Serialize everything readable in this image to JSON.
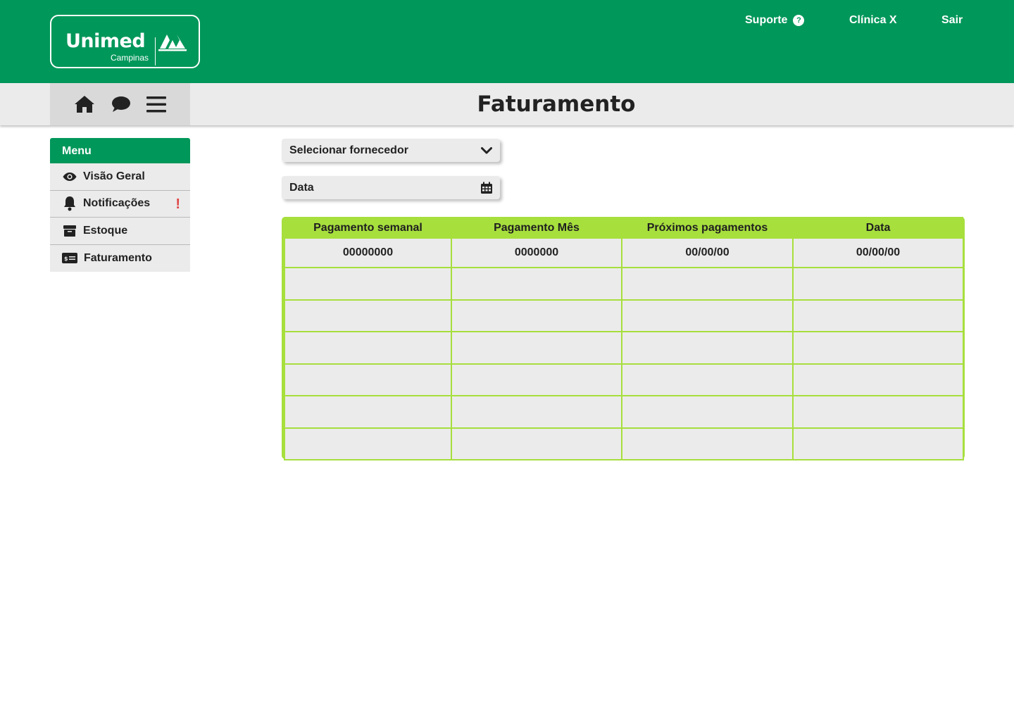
{
  "header": {
    "logo": {
      "word": "Unimed",
      "sub": "Campinas"
    },
    "nav": [
      {
        "label": "Suporte",
        "icon": "help-circle-icon"
      },
      {
        "label": "Clínica X"
      },
      {
        "label": "Sair"
      }
    ]
  },
  "toolbar": {
    "icons": [
      "home-icon",
      "chat-icon",
      "hamburger-menu-icon"
    ],
    "page_title": "Faturamento"
  },
  "sidebar": {
    "title": "Menu",
    "items": [
      {
        "label": "Visão Geral",
        "icon": "eye-icon"
      },
      {
        "label": "Notificações",
        "icon": "bell-icon",
        "alert": "!"
      },
      {
        "label": "Estoque",
        "icon": "box-icon"
      },
      {
        "label": "Faturamento",
        "icon": "billing-card-icon"
      }
    ]
  },
  "filters": {
    "supplier_label": "Selecionar fornecedor",
    "date_label": "Data"
  },
  "table": {
    "columns": [
      "Pagamento semanal",
      "Pagamento Mês",
      "Próximos pagamentos",
      "Data"
    ],
    "rows": [
      [
        "00000000",
        "0000000",
        "00/00/00",
        "00/00/00"
      ],
      [
        "",
        "",
        "",
        ""
      ],
      [
        "",
        "",
        "",
        ""
      ],
      [
        "",
        "",
        "",
        ""
      ],
      [
        "",
        "",
        "",
        ""
      ],
      [
        "",
        "",
        "",
        ""
      ],
      [
        "",
        "",
        "",
        ""
      ]
    ]
  },
  "colors": {
    "brand_green": "#00975a",
    "table_green": "#a7df3d",
    "panel_gray": "#ebebeb",
    "alert_red": "#e04545"
  }
}
